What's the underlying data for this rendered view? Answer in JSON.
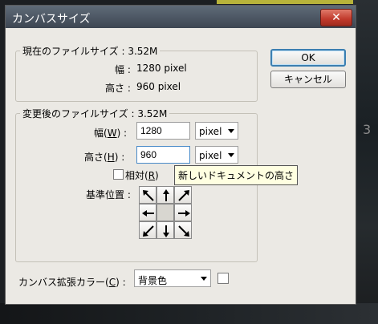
{
  "window": {
    "title": "カンバスサイズ",
    "close_symbol": "✕"
  },
  "current_size": {
    "group_title": "現在のファイルサイズ : 3.52M",
    "width_label": "幅 :",
    "width_value": "1280 pixel",
    "height_label": "高さ :",
    "height_value": "960 pixel"
  },
  "new_size": {
    "group_title": "変更後のファイルサイズ : 3.52M",
    "width_label": "幅(",
    "width_hotkey": "W",
    "width_label_end": ") :",
    "width_value": "1280",
    "width_unit": "pixel",
    "height_label": "高さ(",
    "height_hotkey": "H",
    "height_label_end": ") :",
    "height_value": "960",
    "height_unit": "pixel",
    "relative_label": "相対(",
    "relative_hotkey": "R",
    "relative_label_end": ")",
    "relative_checked": false,
    "anchor_label": "基準位置 :",
    "tooltip": "新しいドキュメントの高さ"
  },
  "anchor": {
    "cells": [
      {
        "name": "anchor-top-left",
        "icon": "arrow-up-left-icon"
      },
      {
        "name": "anchor-top",
        "icon": "arrow-up-icon"
      },
      {
        "name": "anchor-top-right",
        "icon": "arrow-up-right-icon"
      },
      {
        "name": "anchor-left",
        "icon": "arrow-left-icon"
      },
      {
        "name": "anchor-center",
        "icon": "none"
      },
      {
        "name": "anchor-right",
        "icon": "arrow-right-icon"
      },
      {
        "name": "anchor-bottom-left",
        "icon": "arrow-down-left-icon"
      },
      {
        "name": "anchor-bottom",
        "icon": "arrow-down-icon"
      },
      {
        "name": "anchor-bottom-right",
        "icon": "arrow-down-right-icon"
      }
    ],
    "selected": "anchor-center"
  },
  "extension_color": {
    "label": "カンバス拡張カラー(",
    "hotkey": "C",
    "label_end": ") :",
    "value": "背景色",
    "swatch_color": "#ffffff"
  },
  "buttons": {
    "ok": "OK",
    "cancel": "キャンセル"
  },
  "background_text": "3",
  "colors": {
    "titlebar": "#4b5562",
    "close": "#c0392b",
    "dialog_bg": "#ebe9e4",
    "tooltip_bg": "#ffffe1"
  }
}
